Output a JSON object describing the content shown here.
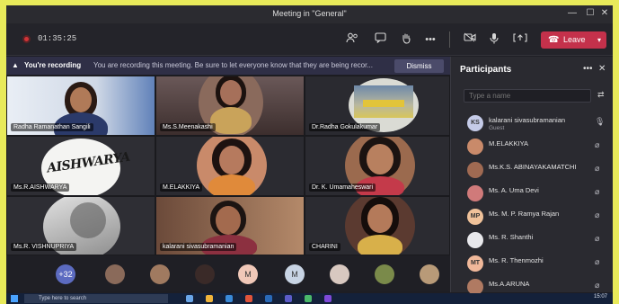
{
  "window": {
    "title": "Meeting in \"General\""
  },
  "window_controls": {
    "minimize": "—",
    "maximize": "☐",
    "close": "✕"
  },
  "toolbar": {
    "timer": "01:35:25",
    "icons": [
      "participants-icon",
      "chat-icon",
      "raise-hand-icon",
      "more-icon",
      "camera-icon",
      "mic-icon",
      "share-icon"
    ],
    "more_glyph": "•••",
    "leave_label": "Leave"
  },
  "banner": {
    "title": "You're recording",
    "message": "You are recording this meeting. Be sure to let everyone know that they are being recor...",
    "dismiss_label": "Dismiss"
  },
  "tiles": [
    {
      "name": "Radha  Ramanathan  Sangili"
    },
    {
      "name": "Ms.S.Meenakashi"
    },
    {
      "name": "Dr.Radha  Gokulakumar"
    },
    {
      "name": "Ms.R.AISHWARYA",
      "logo": "AISHWARYA"
    },
    {
      "name": "M.ELAKKIYA"
    },
    {
      "name": "Dr. K. Umamaheswari"
    },
    {
      "name": "Ms.R. VISHNUPRIYA"
    },
    {
      "name": "kalarani sivasubramanian"
    },
    {
      "name": "CHARINI"
    }
  ],
  "strip": {
    "overflow_count": "+32",
    "avatars": [
      "",
      "",
      "",
      "M",
      "M",
      "",
      "",
      ""
    ]
  },
  "participants": {
    "title": "Participants",
    "search_placeholder": "Type a name",
    "people": [
      {
        "initials": "KS",
        "name": "kalarani sivasubramanian",
        "sub": "Guest"
      },
      {
        "initials": "",
        "name": "M.ELAKKIYA",
        "sub": ""
      },
      {
        "initials": "",
        "name": "Ms.K.S. ABINAYAKAMATCHI",
        "sub": ""
      },
      {
        "initials": "",
        "name": "Ms. A. Uma Devi",
        "sub": ""
      },
      {
        "initials": "MP",
        "name": "Ms. M. P. Ramya Rajan",
        "sub": ""
      },
      {
        "initials": "",
        "name": "Ms. R. Shanthi",
        "sub": ""
      },
      {
        "initials": "MT",
        "name": "Ms. R. Thenmozhi",
        "sub": ""
      },
      {
        "initials": "",
        "name": "Ms.A.ARUNA",
        "sub": ""
      }
    ]
  },
  "taskbar": {
    "search_placeholder": "Type here to search",
    "clock": "15:07"
  },
  "colors": {
    "leave": "#c4314b",
    "record": "#d13438",
    "border": "#e8ea5a",
    "panel": "#2a2a30"
  }
}
